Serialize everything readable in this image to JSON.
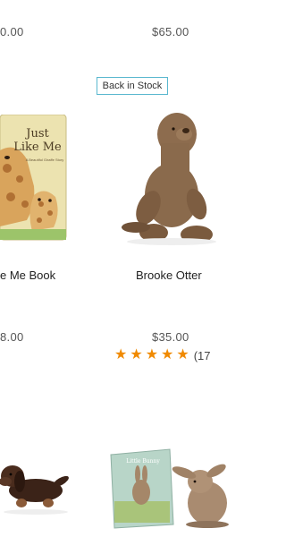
{
  "products": [
    {
      "name": "",
      "price": "0.00"
    },
    {
      "name": "",
      "price": "$65.00"
    },
    {
      "name": "e Me Book",
      "price": "8.00",
      "image": "just-like-me-book-cover",
      "book_title": "Just Like Me",
      "book_subtitle": "A Beautiful Giraffe Story"
    },
    {
      "name": "Brooke Otter",
      "price": "$35.00",
      "badge": "Back in Stock",
      "image": "brooke-otter-plush",
      "rating": 5,
      "review_count": "(17"
    },
    {
      "image": "dachshund-plush"
    },
    {
      "image": "bunny-book-and-plush",
      "book_title": "Little Bunny"
    }
  ],
  "colors": {
    "badge_border": "#5ab8cf",
    "star": "#f08a00"
  }
}
